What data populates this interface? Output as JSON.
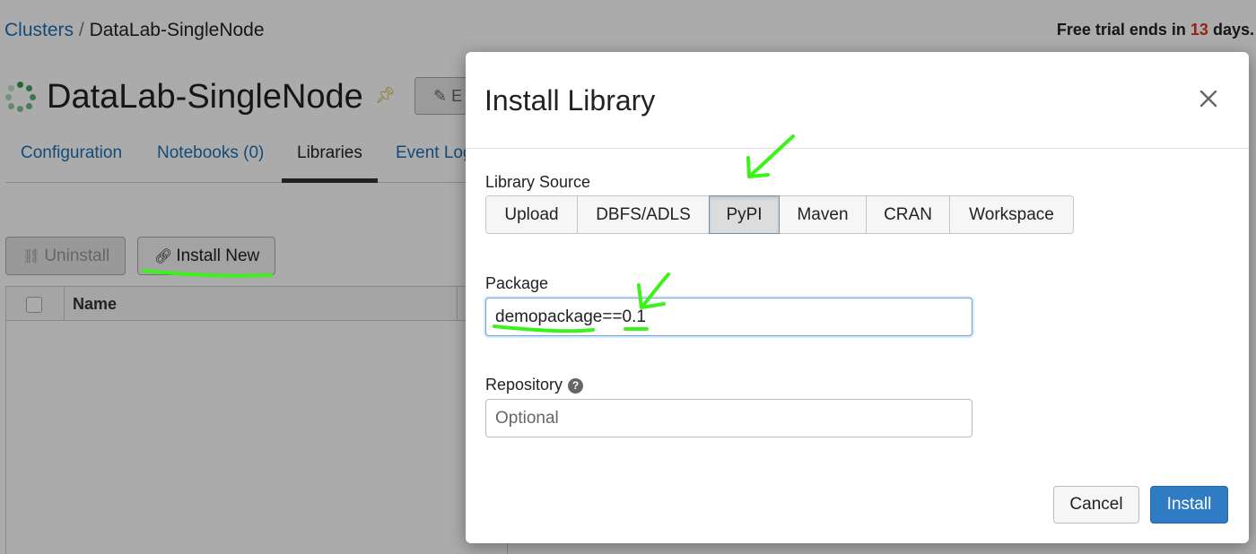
{
  "breadcrumb": {
    "parent": "Clusters",
    "separator": "/",
    "current": "DataLab-SingleNode"
  },
  "trial": {
    "prefix": "Free trial ends in",
    "days": "13",
    "suffix": "days."
  },
  "cluster": {
    "name": "DataLab-SingleNode",
    "edit_label": "E"
  },
  "tabs": [
    {
      "label": "Configuration"
    },
    {
      "label": "Notebooks (0)"
    },
    {
      "label": "Libraries"
    },
    {
      "label": "Event Log"
    }
  ],
  "library_actions": {
    "uninstall_label": "Uninstall",
    "install_new_label": "Install New"
  },
  "library_table": {
    "name_header": "Name"
  },
  "modal": {
    "title": "Install Library",
    "library_source_label": "Library Source",
    "sources": [
      {
        "label": "Upload"
      },
      {
        "label": "DBFS/ADLS"
      },
      {
        "label": "PyPI",
        "selected": true
      },
      {
        "label": "Maven"
      },
      {
        "label": "CRAN"
      },
      {
        "label": "Workspace"
      }
    ],
    "package_label": "Package",
    "package_value": "demopackage==0.1",
    "repository_label": "Repository",
    "repository_placeholder": "Optional",
    "cancel_label": "Cancel",
    "install_label": "Install"
  },
  "colors": {
    "accent": "#2f7cc4",
    "link": "#1f6fb2",
    "annotation": "#3cf21b",
    "warning": "#e0321e"
  }
}
